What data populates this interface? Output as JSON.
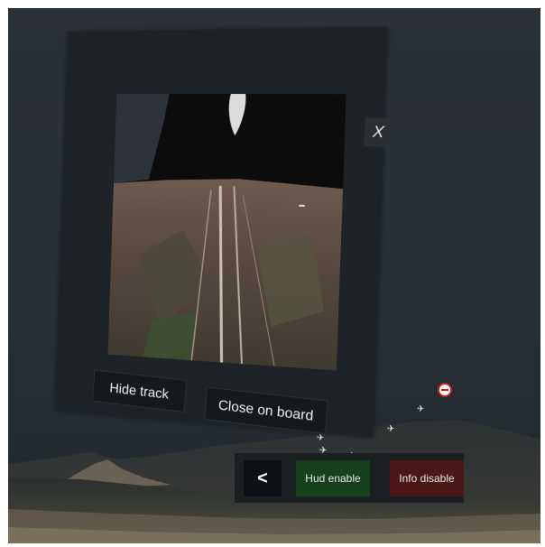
{
  "panel": {
    "close_label": "X",
    "buttons": {
      "hide_track": "Hide track",
      "close_on_board": "Close on board"
    }
  },
  "toolbar": {
    "back_label": "<",
    "hud_label": "Hud enable",
    "info_label": "Info disable"
  },
  "colors": {
    "hud_button": "#17401d",
    "info_button": "#4a1616",
    "target_marker": "#d02020"
  },
  "icons": {
    "target": "target-marker-icon",
    "aircraft": "plane-icon"
  }
}
